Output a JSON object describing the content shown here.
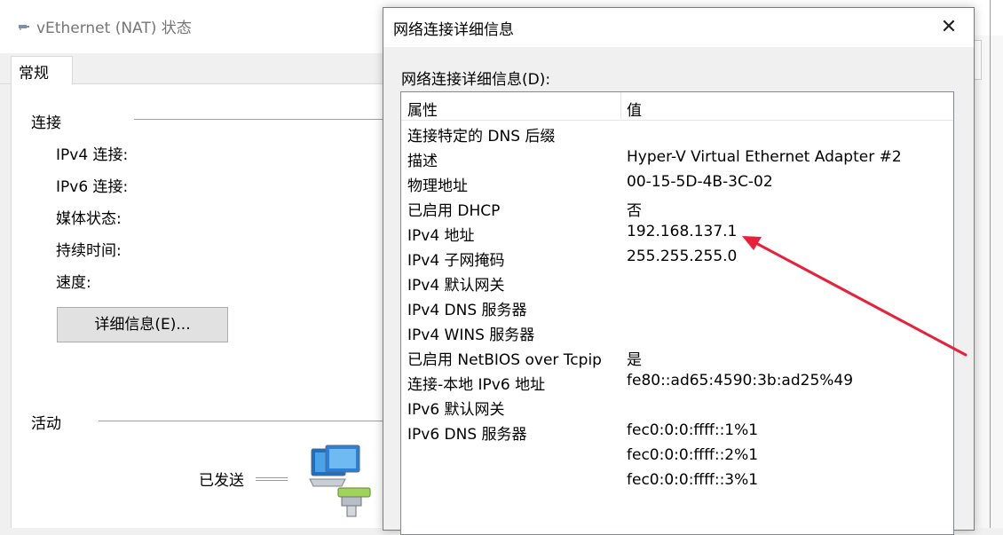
{
  "status_window": {
    "title": "vEthernet (NAT) 状态",
    "tab_general": "常规",
    "connection_group": "连接",
    "fields": [
      "IPv4 连接:",
      "IPv6 连接:",
      "媒体状态:",
      "持续时间:",
      "速度:"
    ],
    "details_button": "详细信息(E)...",
    "activity_group": "活动",
    "sent_label": "已发送"
  },
  "details_dialog": {
    "title": "网络连接详细信息",
    "close_glyph": "✕",
    "list_caption": "网络连接详细信息(D):",
    "columns": {
      "property": "属性",
      "value": "值"
    },
    "rows": [
      {
        "property": "连接特定的 DNS 后缀",
        "value": ""
      },
      {
        "property": "描述",
        "value": "Hyper-V Virtual Ethernet Adapter #2"
      },
      {
        "property": "物理地址",
        "value": "00-15-5D-4B-3C-02"
      },
      {
        "property": "已启用 DHCP",
        "value": "否"
      },
      {
        "property": "IPv4 地址",
        "value": "192.168.137.1"
      },
      {
        "property": "IPv4 子网掩码",
        "value": "255.255.255.0"
      },
      {
        "property": "IPv4 默认网关",
        "value": ""
      },
      {
        "property": "IPv4 DNS 服务器",
        "value": ""
      },
      {
        "property": "IPv4 WINS 服务器",
        "value": ""
      },
      {
        "property": "已启用 NetBIOS over Tcpip",
        "value": "是"
      },
      {
        "property": "连接-本地 IPv6 地址",
        "value": "fe80::ad65:4590:3b:ad25%49"
      },
      {
        "property": "IPv6 默认网关",
        "value": ""
      },
      {
        "property": "IPv6 DNS 服务器",
        "value": "fec0:0:0:ffff::1%1"
      },
      {
        "property": "",
        "value": "fec0:0:0:ffff::2%1"
      },
      {
        "property": "",
        "value": "fec0:0:0:ffff::3%1"
      }
    ]
  },
  "annotation": {
    "arrow_color": "#e8203a",
    "icon": "arrow-icon"
  },
  "icons": {
    "network_adapter": "network-adapter-icon",
    "computers": "network-computers-icon"
  }
}
